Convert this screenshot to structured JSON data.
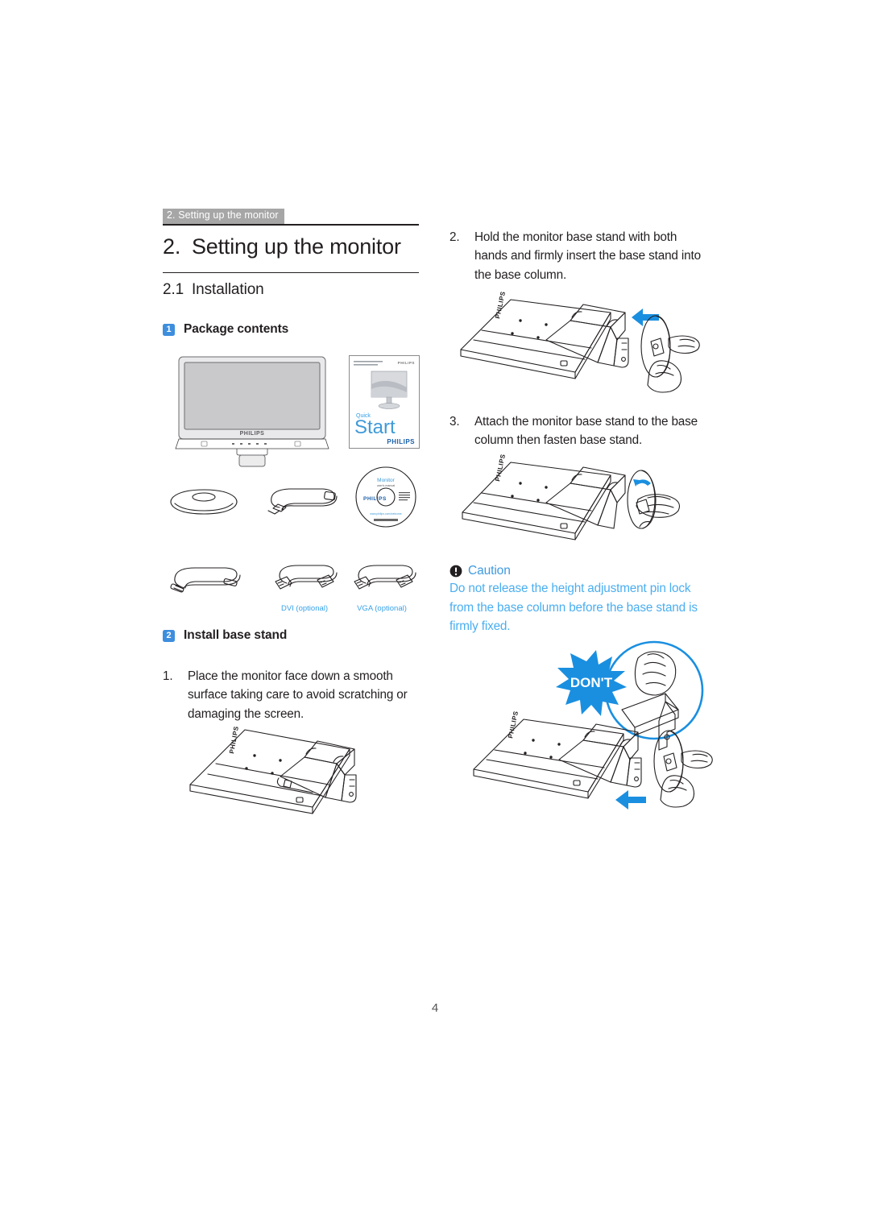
{
  "document": {
    "running_header": "2. Setting up the monitor",
    "page_number": "4"
  },
  "chapter": {
    "number": "2.",
    "title": "Setting up the monitor"
  },
  "section": {
    "number": "2.1",
    "title": "Installation"
  },
  "blocks": {
    "package_contents": {
      "badge": "1",
      "label": "Package contents"
    },
    "install_base_stand": {
      "badge": "2",
      "label": "Install base stand"
    }
  },
  "steps": [
    {
      "number": "1.",
      "text": "Place the monitor face down a smooth surface taking care to avoid scratching or damaging the screen."
    },
    {
      "number": "2.",
      "text": "Hold the monitor base stand with both hands and firmly insert the base stand into the base column."
    },
    {
      "number": "3.",
      "text": "Attach the monitor base stand to the base column then fasten base stand."
    }
  ],
  "caution": {
    "icon": "exclamation-circle-icon",
    "title": "Caution",
    "text": "Do not release the height adjustment pin lock from the base column before the base stand is firmly fixed.",
    "color": "#4aaef0"
  },
  "package_items": {
    "monitor": {
      "name": "monitor-illustration",
      "brand": "PHILIPS"
    },
    "quick_start_guide": {
      "name": "quick-start-guide-illustration",
      "line1": "Quick",
      "line2": "Start",
      "brand": "PHILIPS"
    },
    "base_stand": {
      "name": "base-stand-illustration"
    },
    "power_cord": {
      "name": "power-cord-illustration"
    },
    "cd": {
      "name": "cd-illustration",
      "title": "Monitor",
      "subtitle": "user's manual",
      "brand": "PHILIPS"
    },
    "audio_cable": {
      "name": "audio-cable-illustration",
      "label": ""
    },
    "dvi_cable": {
      "name": "dvi-cable-illustration",
      "label": "DVI (optional)"
    },
    "vga_cable": {
      "name": "vga-cable-illustration",
      "label": "VGA (optional)"
    }
  },
  "figures": {
    "step1_figure": {
      "name": "monitor-face-down-figure"
    },
    "step2_figure": {
      "name": "insert-base-stand-figure"
    },
    "step3_figure": {
      "name": "fasten-base-stand-figure"
    },
    "caution_figure": {
      "name": "dont-release-pin-lock-figure",
      "badge_text": "DON'T"
    }
  },
  "colors": {
    "badge_blue": "#3e8ede",
    "caution_blue": "#4aaef0",
    "arrow_blue": "#1a8fe0",
    "header_tag_gray": "#a6a6a6"
  }
}
